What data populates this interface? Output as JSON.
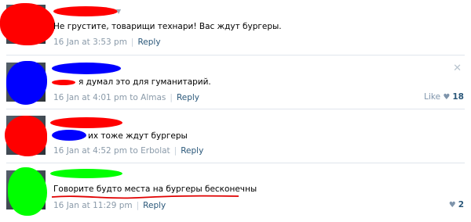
{
  "comments": [
    {
      "text": "Не грустите, товарищи технари! Вас ждут бургеры.",
      "date": "16 Jan at 3:53 pm",
      "separator": "|",
      "reply": "Reply"
    },
    {
      "text": "я думал это для гуманитарий.",
      "date": "16 Jan at 4:01 pm",
      "to_prefix": "to",
      "to_name": "Almas",
      "separator": "|",
      "reply": "Reply",
      "like_label": "Like",
      "like_count": "18",
      "close_glyph": "✕"
    },
    {
      "text": "их тоже ждут бургеры",
      "date": "16 Jan at 4:52 pm",
      "to_prefix": "to",
      "to_name": "Erbolat",
      "separator": "|",
      "reply": "Reply"
    },
    {
      "text": "Говорите будто места на бургеры бесконечны",
      "date": "16 Jan at 11:29 pm",
      "separator": "|",
      "reply": "Reply",
      "like_count": "2"
    }
  ],
  "colors": {
    "link": "#2b587a",
    "meta": "#8a9aa9",
    "scribble_red": "#ff0000",
    "scribble_blue": "#0000ff",
    "scribble_green": "#00ff00",
    "underline_red": "#e00000"
  },
  "icons": {
    "close": "close-icon",
    "heart": "heart-icon",
    "caret": "chevron-down-icon"
  }
}
